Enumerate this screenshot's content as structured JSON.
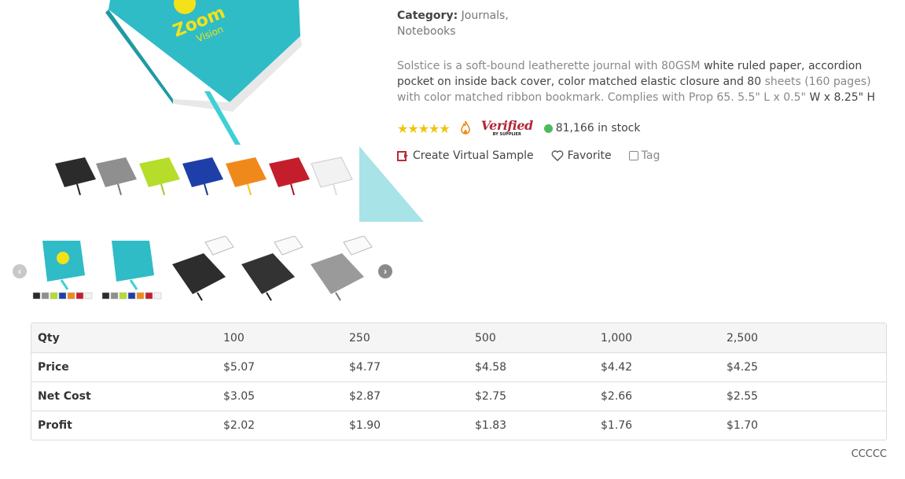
{
  "product": {
    "main_image_brand_line1": "Zoom",
    "main_image_brand_line2": "Vision",
    "category_label": "Category:",
    "category_values_line1": "Journals,",
    "category_values_line2": "Notebooks",
    "description_parts": [
      "Solstice is a soft-bound leatherette journal with 80GSM ",
      "white ruled paper, accordion pocket on inside back cover, color matched elastic closure and 80 ",
      "sheets (160 pages) with color matched ribbon bookmark. Complies with Prop 65. 5.5\" L x 0.5\" ",
      "W x 8.25\" H"
    ],
    "rating_stars": "★★★★★",
    "verified_word": "Verified",
    "verified_sub": "BY SUPPLIER",
    "stock_text": "81,166 in stock",
    "stock_color": "#4cbb5a"
  },
  "actions": {
    "virtual_sample": "Create Virtual Sample",
    "favorite": "Favorite",
    "tag": "Tag"
  },
  "thumbnails": {
    "prev_icon": "‹",
    "next_icon": "›"
  },
  "swatch_colors": [
    "#2b2b2b",
    "#8f8f8f",
    "#b5dd2a",
    "#1f3fa8",
    "#f0891c",
    "#c41e2d",
    "#f2f2f2"
  ],
  "pricing": {
    "header": [
      "Qty",
      "100",
      "250",
      "500",
      "1,000",
      "2,500"
    ],
    "rows": [
      [
        "Price",
        "$5.07",
        "$4.77",
        "$4.58",
        "$4.42",
        "$4.25"
      ],
      [
        "Net Cost",
        "$3.05",
        "$2.87",
        "$2.75",
        "$2.66",
        "$2.55"
      ],
      [
        "Profit",
        "$2.02",
        "$1.90",
        "$1.83",
        "$1.76",
        "$1.70"
      ]
    ]
  },
  "footer_note": "CCCCC"
}
